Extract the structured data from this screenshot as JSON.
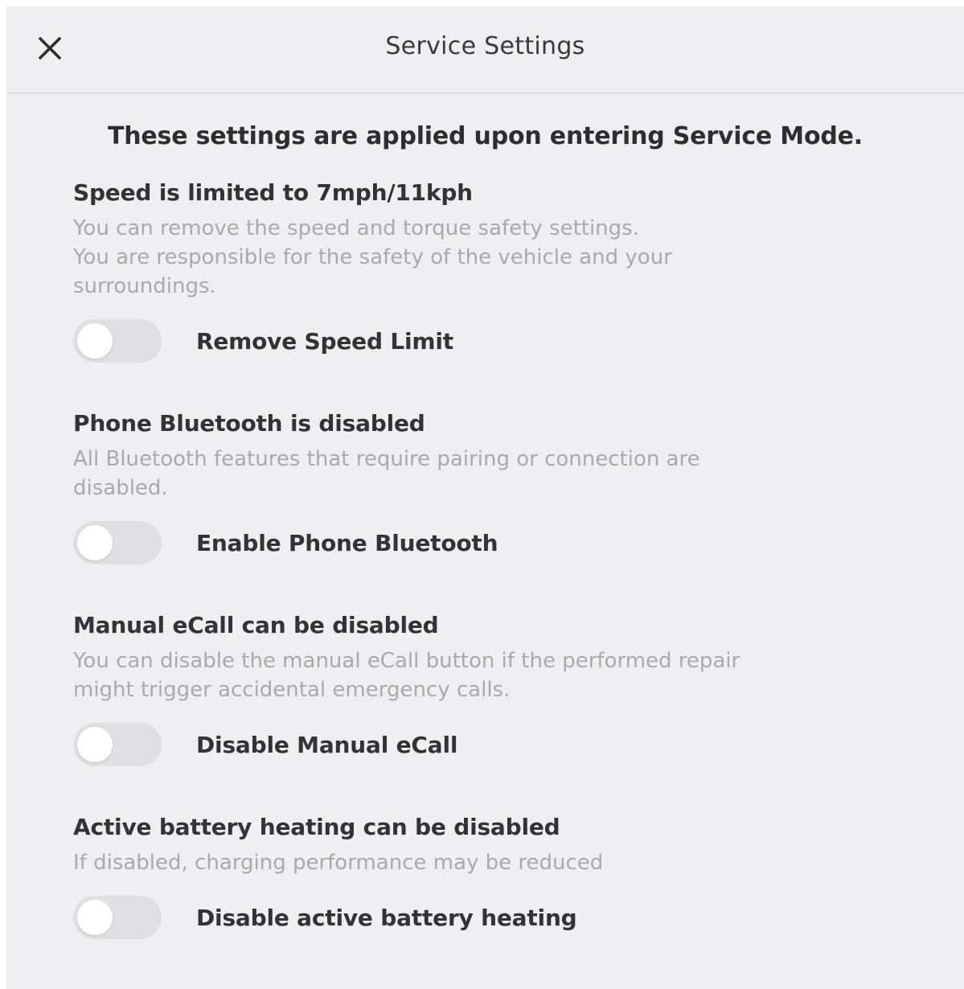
{
  "header": {
    "title": "Service Settings",
    "close_icon": "close-icon"
  },
  "intro": "These settings are applied upon entering Service Mode.",
  "sections": [
    {
      "title": "Speed is limited to 7mph/11kph",
      "description": "You can remove the speed and torque safety settings.\nYou are responsible for the safety of the vehicle and your\nsurroundings.",
      "toggle_label": "Remove Speed Limit",
      "toggle_on": false
    },
    {
      "title": "Phone Bluetooth is disabled",
      "description": "All Bluetooth features that require pairing or connection are\ndisabled.",
      "toggle_label": "Enable Phone Bluetooth",
      "toggle_on": false
    },
    {
      "title": "Manual eCall can be disabled",
      "description": "You can disable the manual eCall button if the performed repair\nmight trigger accidental emergency calls.",
      "toggle_label": "Disable Manual eCall",
      "toggle_on": false
    },
    {
      "title": "Active battery heating can be disabled",
      "description": "If disabled, charging performance may be reduced",
      "toggle_label": "Disable active battery heating",
      "toggle_on": false
    }
  ],
  "colors": {
    "background": "#efeff2",
    "title_text": "#333337",
    "description_text": "#a9a9ae",
    "switch_off": "#e0e0e3",
    "knob": "#ffffff"
  }
}
